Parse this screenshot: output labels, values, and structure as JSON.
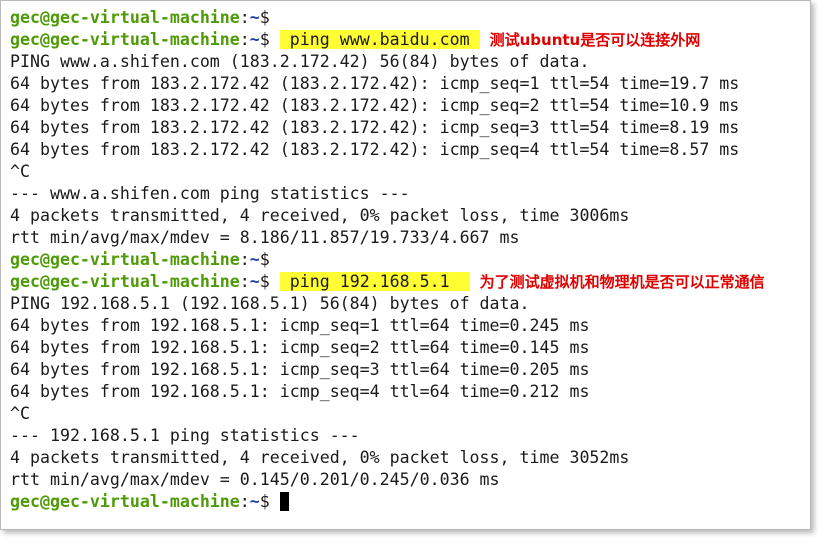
{
  "prompt": {
    "user_host": "gec@gec-virtual-machine",
    "sep": ":",
    "path": "~",
    "dollar": "$ "
  },
  "session1": {
    "command": "ping www.baidu.com",
    "annotation": "测试ubuntu是否可以连接外网",
    "header": "PING www.a.shifen.com (183.2.172.42) 56(84) bytes of data.",
    "replies": [
      "64 bytes from 183.2.172.42 (183.2.172.42): icmp_seq=1 ttl=54 time=19.7 ms",
      "64 bytes from 183.2.172.42 (183.2.172.42): icmp_seq=2 ttl=54 time=10.9 ms",
      "64 bytes from 183.2.172.42 (183.2.172.42): icmp_seq=3 ttl=54 time=8.19 ms",
      "64 bytes from 183.2.172.42 (183.2.172.42): icmp_seq=4 ttl=54 time=8.57 ms"
    ],
    "interrupt": "^C",
    "stats_header": "--- www.a.shifen.com ping statistics ---",
    "stats_packets": "4 packets transmitted, 4 received, 0% packet loss, time 3006ms",
    "stats_rtt": "rtt min/avg/max/mdev = 8.186/11.857/19.733/4.667 ms"
  },
  "session2": {
    "command": "ping 192.168.5.1",
    "annotation": "为了测试虚拟机和物理机是否可以正常通信",
    "header": "PING 192.168.5.1 (192.168.5.1) 56(84) bytes of data.",
    "replies": [
      "64 bytes from 192.168.5.1: icmp_seq=1 ttl=64 time=0.245 ms",
      "64 bytes from 192.168.5.1: icmp_seq=2 ttl=64 time=0.145 ms",
      "64 bytes from 192.168.5.1: icmp_seq=3 ttl=64 time=0.205 ms",
      "64 bytes from 192.168.5.1: icmp_seq=4 ttl=64 time=0.212 ms"
    ],
    "interrupt": "^C",
    "stats_header": "--- 192.168.5.1 ping statistics ---",
    "stats_packets": "4 packets transmitted, 4 received, 0% packet loss, time 3052ms",
    "stats_rtt": "rtt min/avg/max/mdev = 0.145/0.201/0.245/0.036 ms"
  },
  "colors": {
    "prompt_user": "#4e9a06",
    "prompt_path": "#1f3fae",
    "highlight": "#ffff33",
    "annotation": "#e00000"
  }
}
